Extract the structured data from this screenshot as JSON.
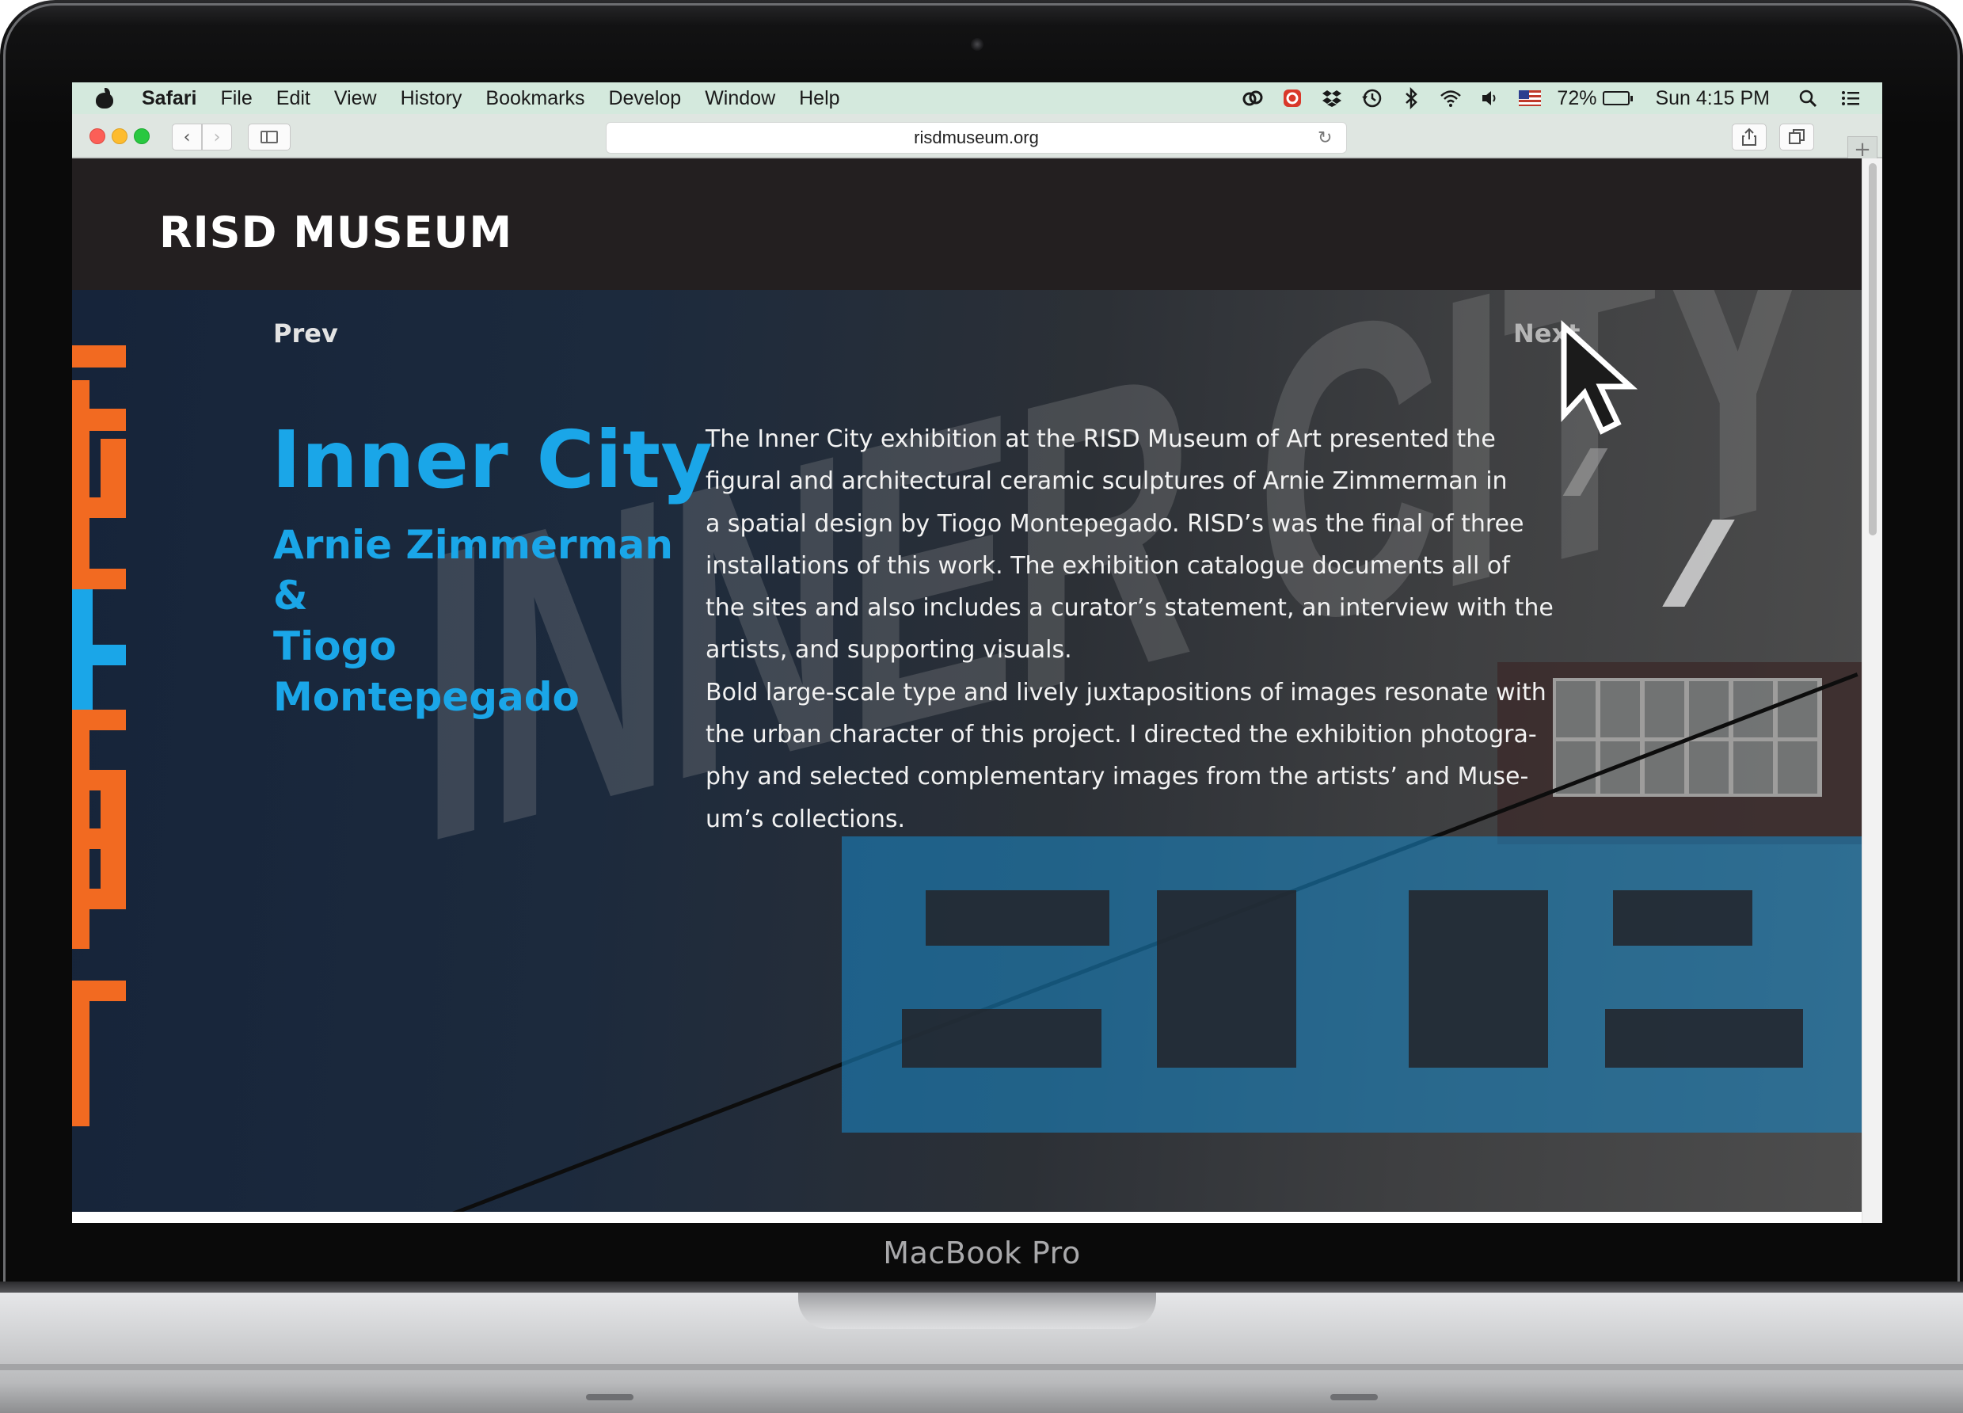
{
  "device": {
    "label": "MacBook Pro"
  },
  "menubar": {
    "app_name": "Safari",
    "items": [
      "File",
      "Edit",
      "View",
      "History",
      "Bookmarks",
      "Develop",
      "Window",
      "Help"
    ],
    "battery_percent": "72%",
    "battery_level": 0.72,
    "clock": "Sun 4:15 PM",
    "status_icons": [
      "creative-cloud-icon",
      "record-icon",
      "dropbox-icon",
      "time-machine-icon",
      "bluetooth-icon",
      "wifi-icon",
      "volume-icon",
      "us-flag-icon",
      "search-icon",
      "list-icon"
    ]
  },
  "browser": {
    "url": "risdmuseum.org",
    "traffic_lights": {
      "close": "#fc5f57",
      "minimize": "#fdbc2e",
      "zoom": "#28c840"
    }
  },
  "site": {
    "logo": "RISD MUSEUM",
    "nav": {
      "prev": "Prev",
      "next": "Next"
    },
    "exhibition": {
      "title": "Inner City",
      "artists_line1": "Arnie Zimmerman &",
      "artists_line2": "Tiogo Montepegado",
      "description_lines": [
        "The Inner City exhibition at the RISD Museum of Art presented the",
        "figural and architectural ceramic sculptures of Arnie Zimmerman in",
        "a spatial design by Tiogo Montepegado. RISD’s was the final of three",
        "installations of this work. The exhibition catalogue documents all of",
        "the sites and also includes a curator’s statement, an interview with the",
        "artists, and supporting visuals.",
        "Bold large-scale type and lively juxtapositions of images resonate with",
        "the urban character of this project. I directed the exhibition photogra-",
        "phy and selected complementary images from the artists’ and Muse-",
        "um’s collections."
      ]
    },
    "hero_photo_text": "INNER CITY",
    "colors": {
      "accent_blue": "#1aa6e8",
      "accent_orange": "#f26a21",
      "header_bg": "#231f20",
      "overlay_teal": "#1a86c4"
    }
  }
}
